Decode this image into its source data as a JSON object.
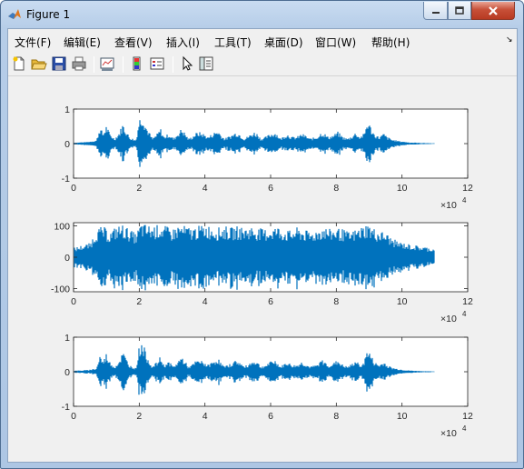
{
  "window": {
    "title": "Figure 1",
    "icon": "matlab-icon",
    "controls": [
      "minimize-icon",
      "maximize-icon",
      "close-icon"
    ]
  },
  "menu": {
    "items": [
      "文件(F)",
      "编辑(E)",
      "查看(V)",
      "插入(I)",
      "工具(T)",
      "桌面(D)",
      "窗口(W)",
      "帮助(H)"
    ]
  },
  "toolbar": {
    "buttons": [
      "new-figure-icon",
      "open-file-icon",
      "save-icon",
      "print-icon",
      "link-plot-icon",
      "insert-colorbar-icon",
      "insert-legend-icon",
      "edit-plot-arrow-icon",
      "show-plot-tools-icon"
    ]
  },
  "colors": {
    "signal": "#0072bd",
    "axes_bg": "#ffffff",
    "figure_bg": "#f0f0f0"
  },
  "chart_data": [
    {
      "type": "line",
      "xlim": [
        0,
        120000
      ],
      "ylim": [
        -1,
        1
      ],
      "x_ticks": [
        "0",
        "2",
        "4",
        "6",
        "8",
        "10",
        "12"
      ],
      "y_ticks": [
        "-1",
        "0",
        "1"
      ],
      "x_multiplier": "×10",
      "x_multiplier_exp": "4",
      "signal_end": 110000,
      "envelope": [
        [
          0,
          0.03
        ],
        [
          4000,
          0.05
        ],
        [
          7000,
          0.1
        ],
        [
          8000,
          0.5
        ],
        [
          9000,
          0.3
        ],
        [
          10000,
          0.55
        ],
        [
          11000,
          0.3
        ],
        [
          12500,
          0.15
        ],
        [
          14000,
          0.35
        ],
        [
          15000,
          0.6
        ],
        [
          16000,
          0.4
        ],
        [
          17000,
          0.2
        ],
        [
          19000,
          0.1
        ],
        [
          20000,
          0.75
        ],
        [
          21000,
          0.9
        ],
        [
          22000,
          0.55
        ],
        [
          23000,
          0.35
        ],
        [
          24000,
          0.15
        ],
        [
          25500,
          0.3
        ],
        [
          26500,
          0.45
        ],
        [
          27500,
          0.2
        ],
        [
          29000,
          0.3
        ],
        [
          30500,
          0.15
        ],
        [
          32000,
          0.35
        ],
        [
          33000,
          0.45
        ],
        [
          34000,
          0.3
        ],
        [
          35000,
          0.15
        ],
        [
          36000,
          0.2
        ],
        [
          37000,
          0.3
        ],
        [
          38000,
          0.35
        ],
        [
          39500,
          0.3
        ],
        [
          41000,
          0.2
        ],
        [
          43000,
          0.35
        ],
        [
          44000,
          0.4
        ],
        [
          45000,
          0.25
        ],
        [
          46000,
          0.15
        ],
        [
          48000,
          0.25
        ],
        [
          49500,
          0.35
        ],
        [
          50500,
          0.3
        ],
        [
          52000,
          0.15
        ],
        [
          53500,
          0.25
        ],
        [
          55000,
          0.35
        ],
        [
          56000,
          0.3
        ],
        [
          57000,
          0.15
        ],
        [
          58500,
          0.2
        ],
        [
          60000,
          0.3
        ],
        [
          61500,
          0.35
        ],
        [
          63000,
          0.15
        ],
        [
          65000,
          0.3
        ],
        [
          66500,
          0.2
        ],
        [
          68000,
          0.2
        ],
        [
          69500,
          0.3
        ],
        [
          70500,
          0.25
        ],
        [
          72000,
          0.15
        ],
        [
          74000,
          0.2
        ],
        [
          75500,
          0.35
        ],
        [
          76500,
          0.3
        ],
        [
          77500,
          0.2
        ],
        [
          79000,
          0.25
        ],
        [
          80500,
          0.35
        ],
        [
          82000,
          0.2
        ],
        [
          83500,
          0.15
        ],
        [
          85000,
          0.25
        ],
        [
          86000,
          0.35
        ],
        [
          87000,
          0.2
        ],
        [
          88500,
          0.3
        ],
        [
          89500,
          0.7
        ],
        [
          90500,
          0.5
        ],
        [
          91500,
          0.3
        ],
        [
          93000,
          0.2
        ],
        [
          94500,
          0.3
        ],
        [
          95500,
          0.2
        ],
        [
          97000,
          0.12
        ],
        [
          99000,
          0.08
        ],
        [
          102000,
          0.04
        ],
        [
          106000,
          0.02
        ],
        [
          110000,
          0.01
        ]
      ]
    },
    {
      "type": "line",
      "xlim": [
        0,
        120000
      ],
      "ylim": [
        -110,
        110
      ],
      "x_ticks": [
        "0",
        "2",
        "4",
        "6",
        "8",
        "10",
        "12"
      ],
      "y_ticks": [
        "-100",
        "0",
        "100"
      ],
      "x_multiplier": "×10",
      "x_multiplier_exp": "4",
      "signal_end": 110000,
      "envelope": [
        [
          0,
          30
        ],
        [
          3000,
          40
        ],
        [
          5000,
          45
        ],
        [
          7000,
          90
        ],
        [
          9000,
          100
        ],
        [
          11000,
          80
        ],
        [
          13000,
          100
        ],
        [
          15000,
          105
        ],
        [
          17000,
          90
        ],
        [
          19000,
          75
        ],
        [
          20500,
          110
        ],
        [
          22000,
          105
        ],
        [
          24000,
          100
        ],
        [
          26000,
          105
        ],
        [
          28000,
          100
        ],
        [
          30000,
          90
        ],
        [
          32000,
          105
        ],
        [
          34000,
          100
        ],
        [
          36000,
          95
        ],
        [
          38000,
          100
        ],
        [
          40000,
          105
        ],
        [
          42000,
          100
        ],
        [
          44000,
          95
        ],
        [
          46000,
          100
        ],
        [
          48000,
          95
        ],
        [
          50000,
          100
        ],
        [
          52000,
          95
        ],
        [
          54000,
          100
        ],
        [
          56000,
          95
        ],
        [
          58000,
          90
        ],
        [
          60000,
          95
        ],
        [
          62000,
          100
        ],
        [
          64000,
          90
        ],
        [
          66000,
          85
        ],
        [
          68000,
          95
        ],
        [
          70000,
          90
        ],
        [
          72000,
          80
        ],
        [
          74000,
          90
        ],
        [
          76000,
          100
        ],
        [
          78000,
          90
        ],
        [
          80000,
          95
        ],
        [
          82000,
          90
        ],
        [
          84000,
          80
        ],
        [
          86000,
          90
        ],
        [
          88000,
          100
        ],
        [
          89500,
          110
        ],
        [
          91000,
          95
        ],
        [
          93000,
          85
        ],
        [
          95000,
          80
        ],
        [
          97000,
          60
        ],
        [
          99000,
          50
        ],
        [
          101000,
          45
        ],
        [
          103000,
          40
        ],
        [
          106000,
          35
        ],
        [
          109000,
          30
        ],
        [
          110000,
          28
        ]
      ]
    },
    {
      "type": "line",
      "xlim": [
        0,
        120000
      ],
      "ylim": [
        -1,
        1
      ],
      "x_ticks": [
        "0",
        "2",
        "4",
        "6",
        "8",
        "10",
        "12"
      ],
      "y_ticks": [
        "-1",
        "0",
        "1"
      ],
      "x_multiplier": "×10",
      "x_multiplier_exp": "4",
      "signal_end": 110000,
      "envelope": [
        [
          0,
          0.03
        ],
        [
          4000,
          0.05
        ],
        [
          7000,
          0.1
        ],
        [
          8000,
          0.5
        ],
        [
          9000,
          0.3
        ],
        [
          10000,
          0.55
        ],
        [
          11000,
          0.3
        ],
        [
          12500,
          0.15
        ],
        [
          14000,
          0.35
        ],
        [
          15000,
          0.6
        ],
        [
          16000,
          0.4
        ],
        [
          17000,
          0.2
        ],
        [
          19000,
          0.1
        ],
        [
          20000,
          0.75
        ],
        [
          21000,
          0.9
        ],
        [
          22000,
          0.55
        ],
        [
          23000,
          0.35
        ],
        [
          24000,
          0.15
        ],
        [
          25500,
          0.3
        ],
        [
          26500,
          0.45
        ],
        [
          27500,
          0.2
        ],
        [
          29000,
          0.3
        ],
        [
          30500,
          0.15
        ],
        [
          32000,
          0.35
        ],
        [
          33000,
          0.45
        ],
        [
          34000,
          0.3
        ],
        [
          35000,
          0.15
        ],
        [
          36000,
          0.2
        ],
        [
          37000,
          0.3
        ],
        [
          38000,
          0.35
        ],
        [
          39500,
          0.3
        ],
        [
          41000,
          0.2
        ],
        [
          43000,
          0.35
        ],
        [
          44000,
          0.4
        ],
        [
          45000,
          0.25
        ],
        [
          46000,
          0.15
        ],
        [
          48000,
          0.25
        ],
        [
          49500,
          0.35
        ],
        [
          50500,
          0.3
        ],
        [
          52000,
          0.15
        ],
        [
          53500,
          0.25
        ],
        [
          55000,
          0.35
        ],
        [
          56000,
          0.3
        ],
        [
          57000,
          0.15
        ],
        [
          58500,
          0.2
        ],
        [
          60000,
          0.3
        ],
        [
          61500,
          0.35
        ],
        [
          63000,
          0.15
        ],
        [
          65000,
          0.3
        ],
        [
          66500,
          0.2
        ],
        [
          68000,
          0.2
        ],
        [
          69500,
          0.3
        ],
        [
          70500,
          0.25
        ],
        [
          72000,
          0.15
        ],
        [
          74000,
          0.2
        ],
        [
          75500,
          0.35
        ],
        [
          76500,
          0.3
        ],
        [
          77500,
          0.2
        ],
        [
          79000,
          0.25
        ],
        [
          80500,
          0.35
        ],
        [
          82000,
          0.2
        ],
        [
          83500,
          0.15
        ],
        [
          85000,
          0.25
        ],
        [
          86000,
          0.35
        ],
        [
          87000,
          0.2
        ],
        [
          88500,
          0.3
        ],
        [
          89500,
          0.7
        ],
        [
          90500,
          0.5
        ],
        [
          91500,
          0.3
        ],
        [
          93000,
          0.2
        ],
        [
          94500,
          0.3
        ],
        [
          95500,
          0.2
        ],
        [
          97000,
          0.12
        ],
        [
          99000,
          0.08
        ],
        [
          102000,
          0.04
        ],
        [
          106000,
          0.02
        ],
        [
          110000,
          0.01
        ]
      ]
    }
  ]
}
